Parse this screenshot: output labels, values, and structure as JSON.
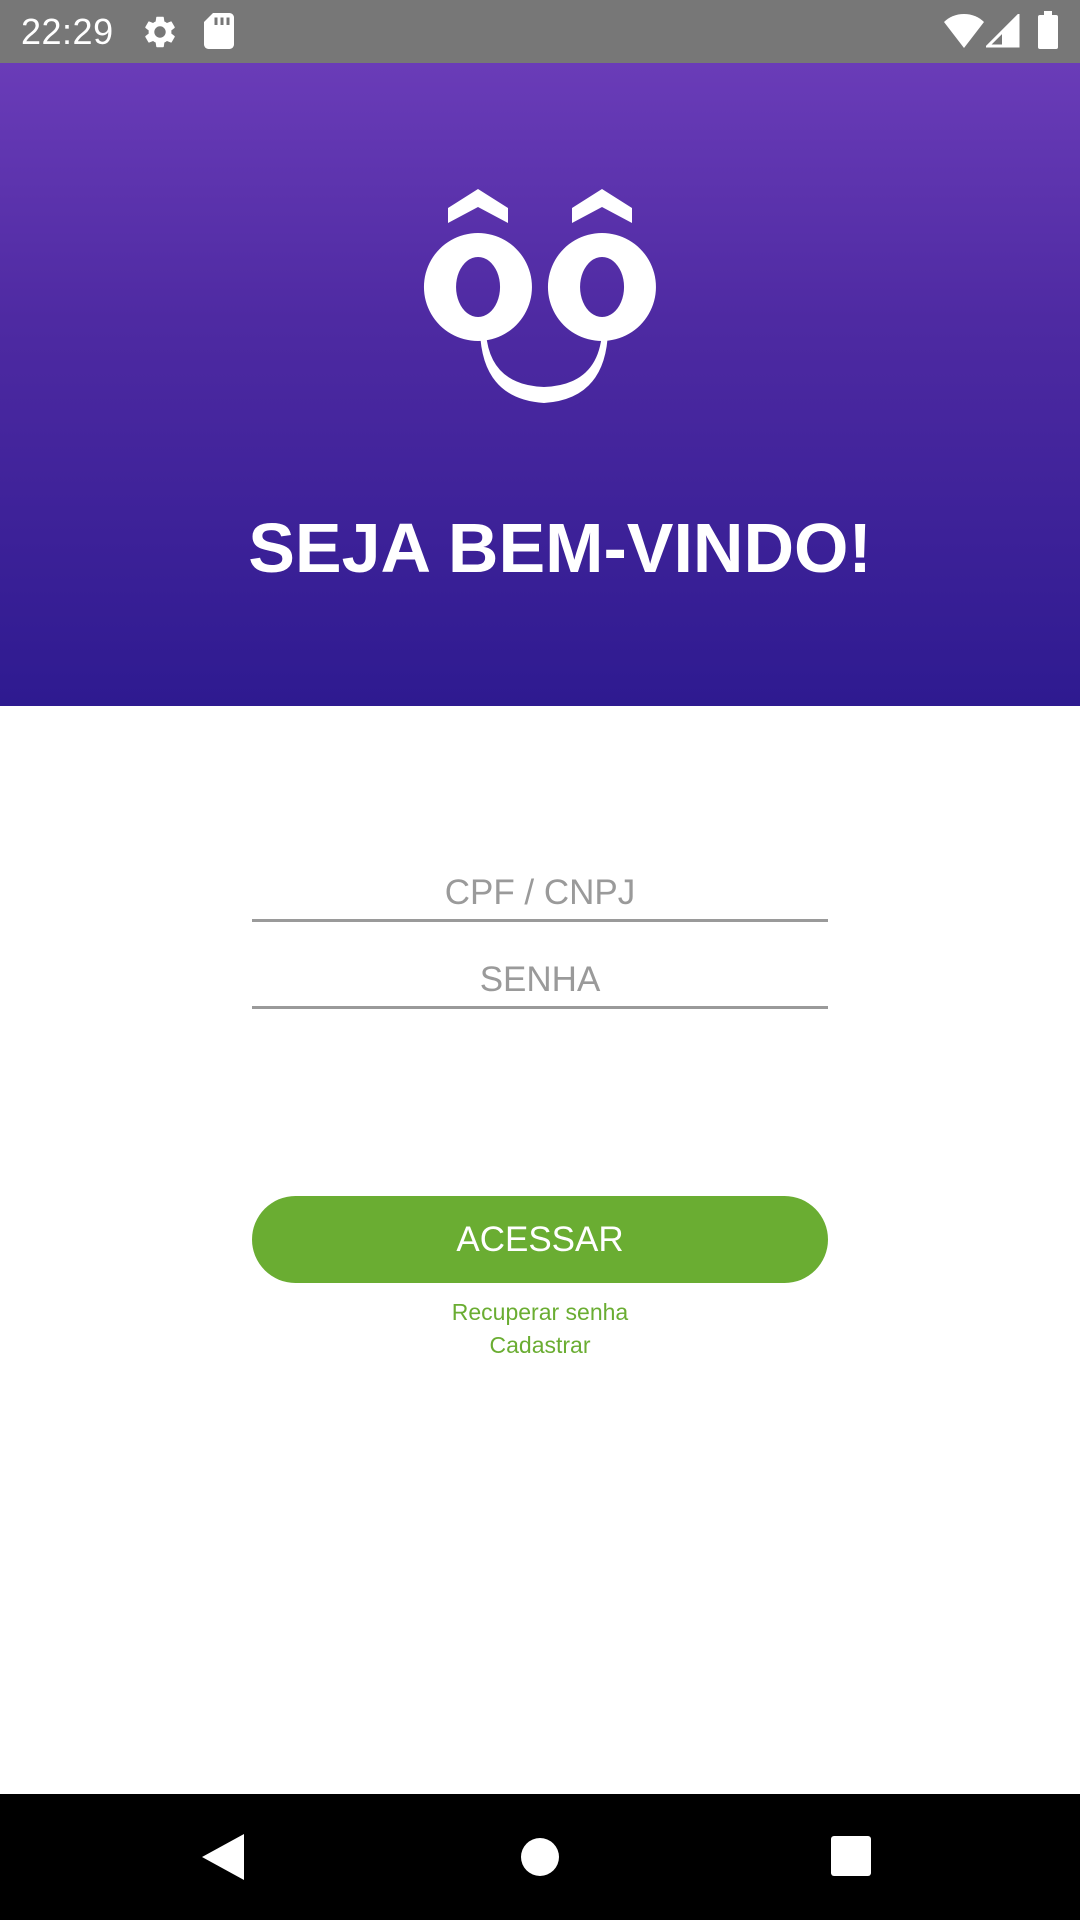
{
  "status_bar": {
    "time": "22:29",
    "left_icons": [
      "gear-icon",
      "sd-card-icon"
    ],
    "right_icons": [
      "wifi-icon",
      "signal-icon",
      "battery-icon"
    ]
  },
  "header": {
    "logo_icon": "smiley-logo-icon",
    "welcome_text": "SEJA BEM-VINDO!",
    "gradient_top": "#6a3cb8",
    "gradient_bottom": "#2e1a90"
  },
  "form": {
    "cpf_placeholder": "CPF / CNPJ",
    "cpf_value": "",
    "password_placeholder": "SENHA",
    "password_value": "",
    "submit_label": "ACESSAR",
    "recover_link": "Recuperar senha",
    "register_link": "Cadastrar",
    "accent_color": "#6aad32"
  },
  "nav_bar": {
    "buttons": [
      "back-icon",
      "home-icon",
      "recents-icon"
    ]
  }
}
